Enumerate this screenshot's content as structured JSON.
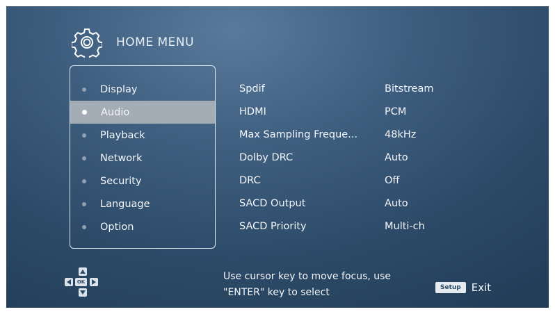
{
  "header": {
    "icon": "gear-icon",
    "title": "HOME MENU"
  },
  "menu": {
    "items": [
      {
        "label": "Display",
        "selected": false
      },
      {
        "label": "Audio",
        "selected": true
      },
      {
        "label": "Playback",
        "selected": false
      },
      {
        "label": "Network",
        "selected": false
      },
      {
        "label": "Security",
        "selected": false
      },
      {
        "label": "Language",
        "selected": false
      },
      {
        "label": "Option",
        "selected": false
      }
    ]
  },
  "settings": [
    {
      "name": "Spdif",
      "value": "Bitstream"
    },
    {
      "name": "HDMI",
      "value": "PCM"
    },
    {
      "name": "Max Sampling Freque...",
      "value": "48kHz"
    },
    {
      "name": "Dolby DRC",
      "value": "Auto"
    },
    {
      "name": "DRC",
      "value": "Off"
    },
    {
      "name": "SACD Output",
      "value": "Auto"
    },
    {
      "name": "SACD Priority",
      "value": "Multi-ch"
    }
  ],
  "footer": {
    "dpad_ok": "OK",
    "help_line1": "Use cursor key to move focus, use",
    "help_line2": "\"ENTER\" key to select",
    "setup_key": "Setup",
    "exit_label": "Exit"
  },
  "colors": {
    "background": "#3f5f80",
    "selected_row": "#a4adb6",
    "text": "#f3f6fa"
  }
}
